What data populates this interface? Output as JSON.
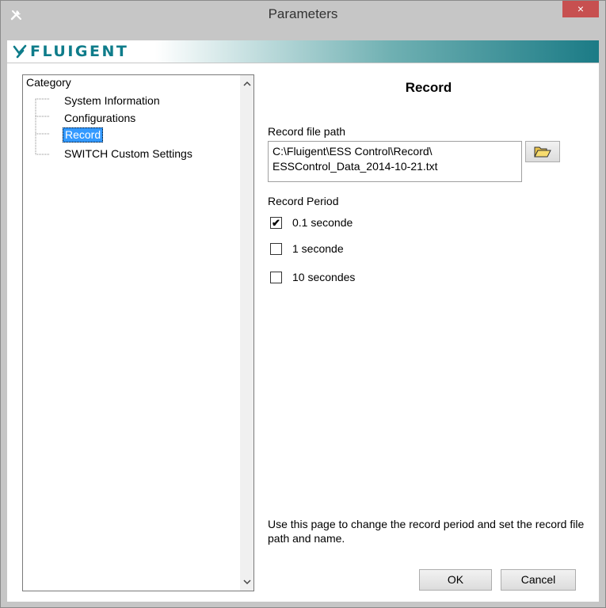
{
  "window": {
    "title": "Parameters",
    "close_glyph": "×"
  },
  "banner": {
    "logo_text": "FLUIGENT"
  },
  "tree": {
    "header": "Category",
    "items": [
      {
        "label": "System Information"
      },
      {
        "label": "Configurations"
      },
      {
        "label": "Record",
        "selected": true
      },
      {
        "label": "SWITCH Custom Settings"
      }
    ]
  },
  "page": {
    "title": "Record",
    "record_path_label": "Record file path",
    "record_path_line1": "C:\\Fluigent\\ESS Control\\Record\\",
    "record_path_line2": "ESSControl_Data_2014-10-21.txt",
    "record_period_label": "Record Period",
    "periods": [
      {
        "label": "0.1 seconde",
        "checked": true
      },
      {
        "label": "1 seconde",
        "checked": false
      },
      {
        "label": "10 secondes",
        "checked": false
      }
    ],
    "description": "Use this page to change the record period and set the record file path and name."
  },
  "buttons": {
    "ok": "OK",
    "cancel": "Cancel"
  },
  "colors": {
    "selection": "#3399ff",
    "close": "#c75050",
    "brand": "#0e7c8a"
  }
}
